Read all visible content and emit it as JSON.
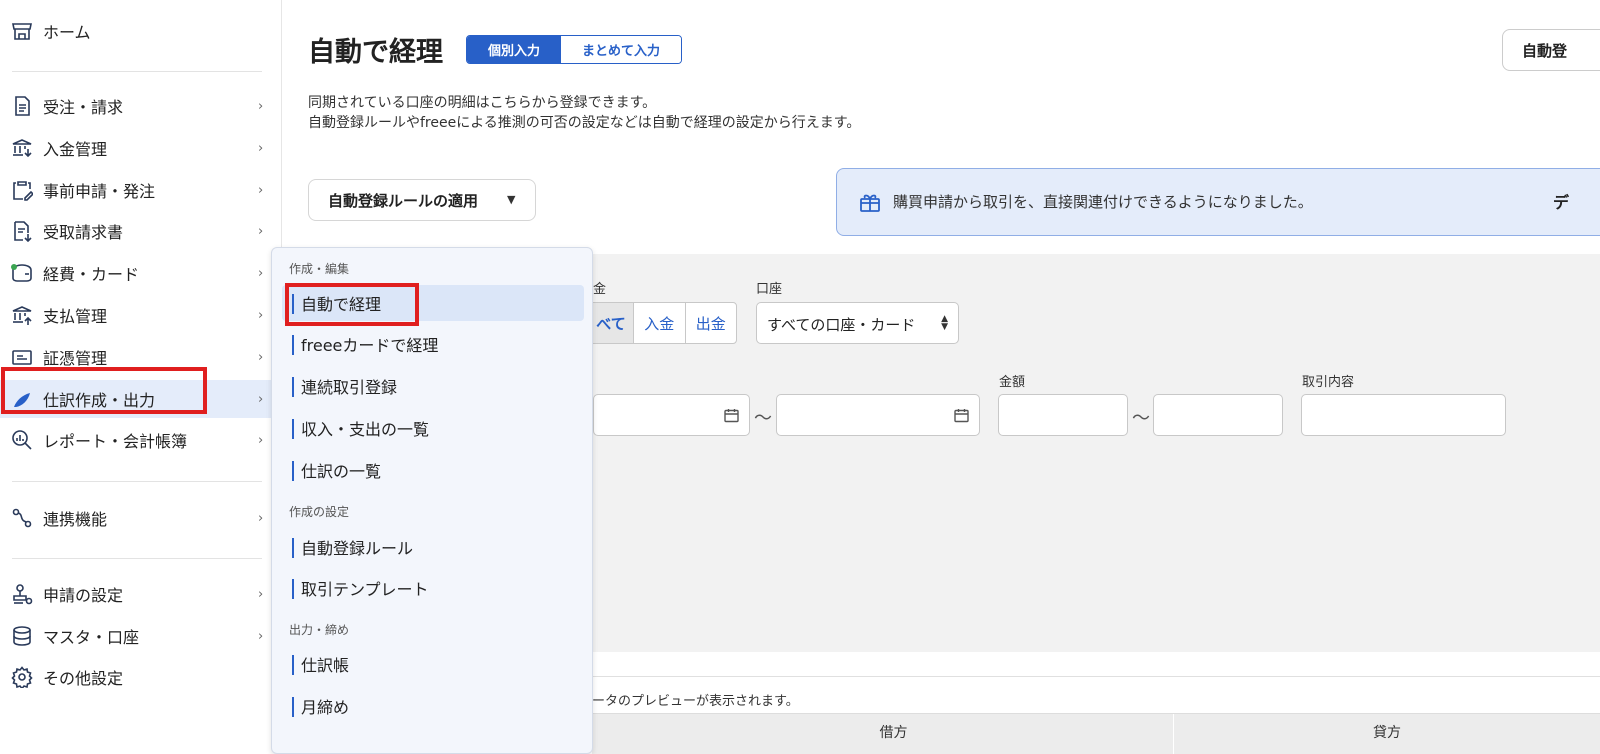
{
  "sidebar": {
    "home": "ホーム",
    "items": [
      {
        "label": "受注・請求",
        "chevron": "›"
      },
      {
        "label": "入金管理",
        "chevron": "›"
      },
      {
        "label": "事前申請・発注",
        "chevron": "›"
      },
      {
        "label": "受取請求書",
        "chevron": "›"
      },
      {
        "label": "経費・カード",
        "chevron": "›"
      },
      {
        "label": "支払管理",
        "chevron": "›"
      },
      {
        "label": "証憑管理",
        "chevron": "›"
      },
      {
        "label": "仕訳作成・出力",
        "chevron": "›"
      },
      {
        "label": "レポート・会計帳簿",
        "chevron": "›"
      },
      {
        "label": "連携機能",
        "chevron": "›"
      },
      {
        "label": "申請の設定",
        "chevron": "›"
      },
      {
        "label": "マスタ・口座",
        "chevron": "›"
      },
      {
        "label": "その他設定",
        "chevron": ""
      }
    ]
  },
  "header": {
    "title": "自動で経理",
    "seg_individual": "個別入力",
    "seg_bulk": "まとめて入力",
    "top_right_button": "自動登"
  },
  "description": {
    "line1": "同期されている口座の明細はこちらから登録できます。",
    "line2": "自動登録ルールやfreeeによる推測の可否の設定などは自動で経理の設定から行えます。"
  },
  "rule_button": {
    "label": "自動登録ルールの適用",
    "caret": "▼"
  },
  "notice": {
    "text": "購買申請から取引を、直接関連付けできるようになりました。",
    "tail": "デ"
  },
  "filters": {
    "type_label_partial": "金",
    "type_options": [
      "べて",
      "入金",
      "出金"
    ],
    "account_label": "口座",
    "account_value": "すべての口座・カード",
    "amount_label": "金額",
    "content_label": "取引内容",
    "tilde": "〜"
  },
  "preview": {
    "text": "ータのプレビューが表示されます。",
    "col_debit": "借方",
    "col_credit": "貸方"
  },
  "menu": {
    "section1": "作成・編集",
    "items1": [
      "自動で経理",
      "freeeカードで経理",
      "連続取引登録",
      "収入・支出の一覧",
      "仕訳の一覧"
    ],
    "section2": "作成の設定",
    "items2": [
      "自動登録ルール",
      "取引テンプレート"
    ],
    "section3": "出力・締め",
    "items3": [
      "仕訳帳",
      "月締め"
    ]
  },
  "colors": {
    "accent": "#2860c8",
    "highlight": "#e01f1f",
    "notice_bg": "#e4ecfa"
  }
}
